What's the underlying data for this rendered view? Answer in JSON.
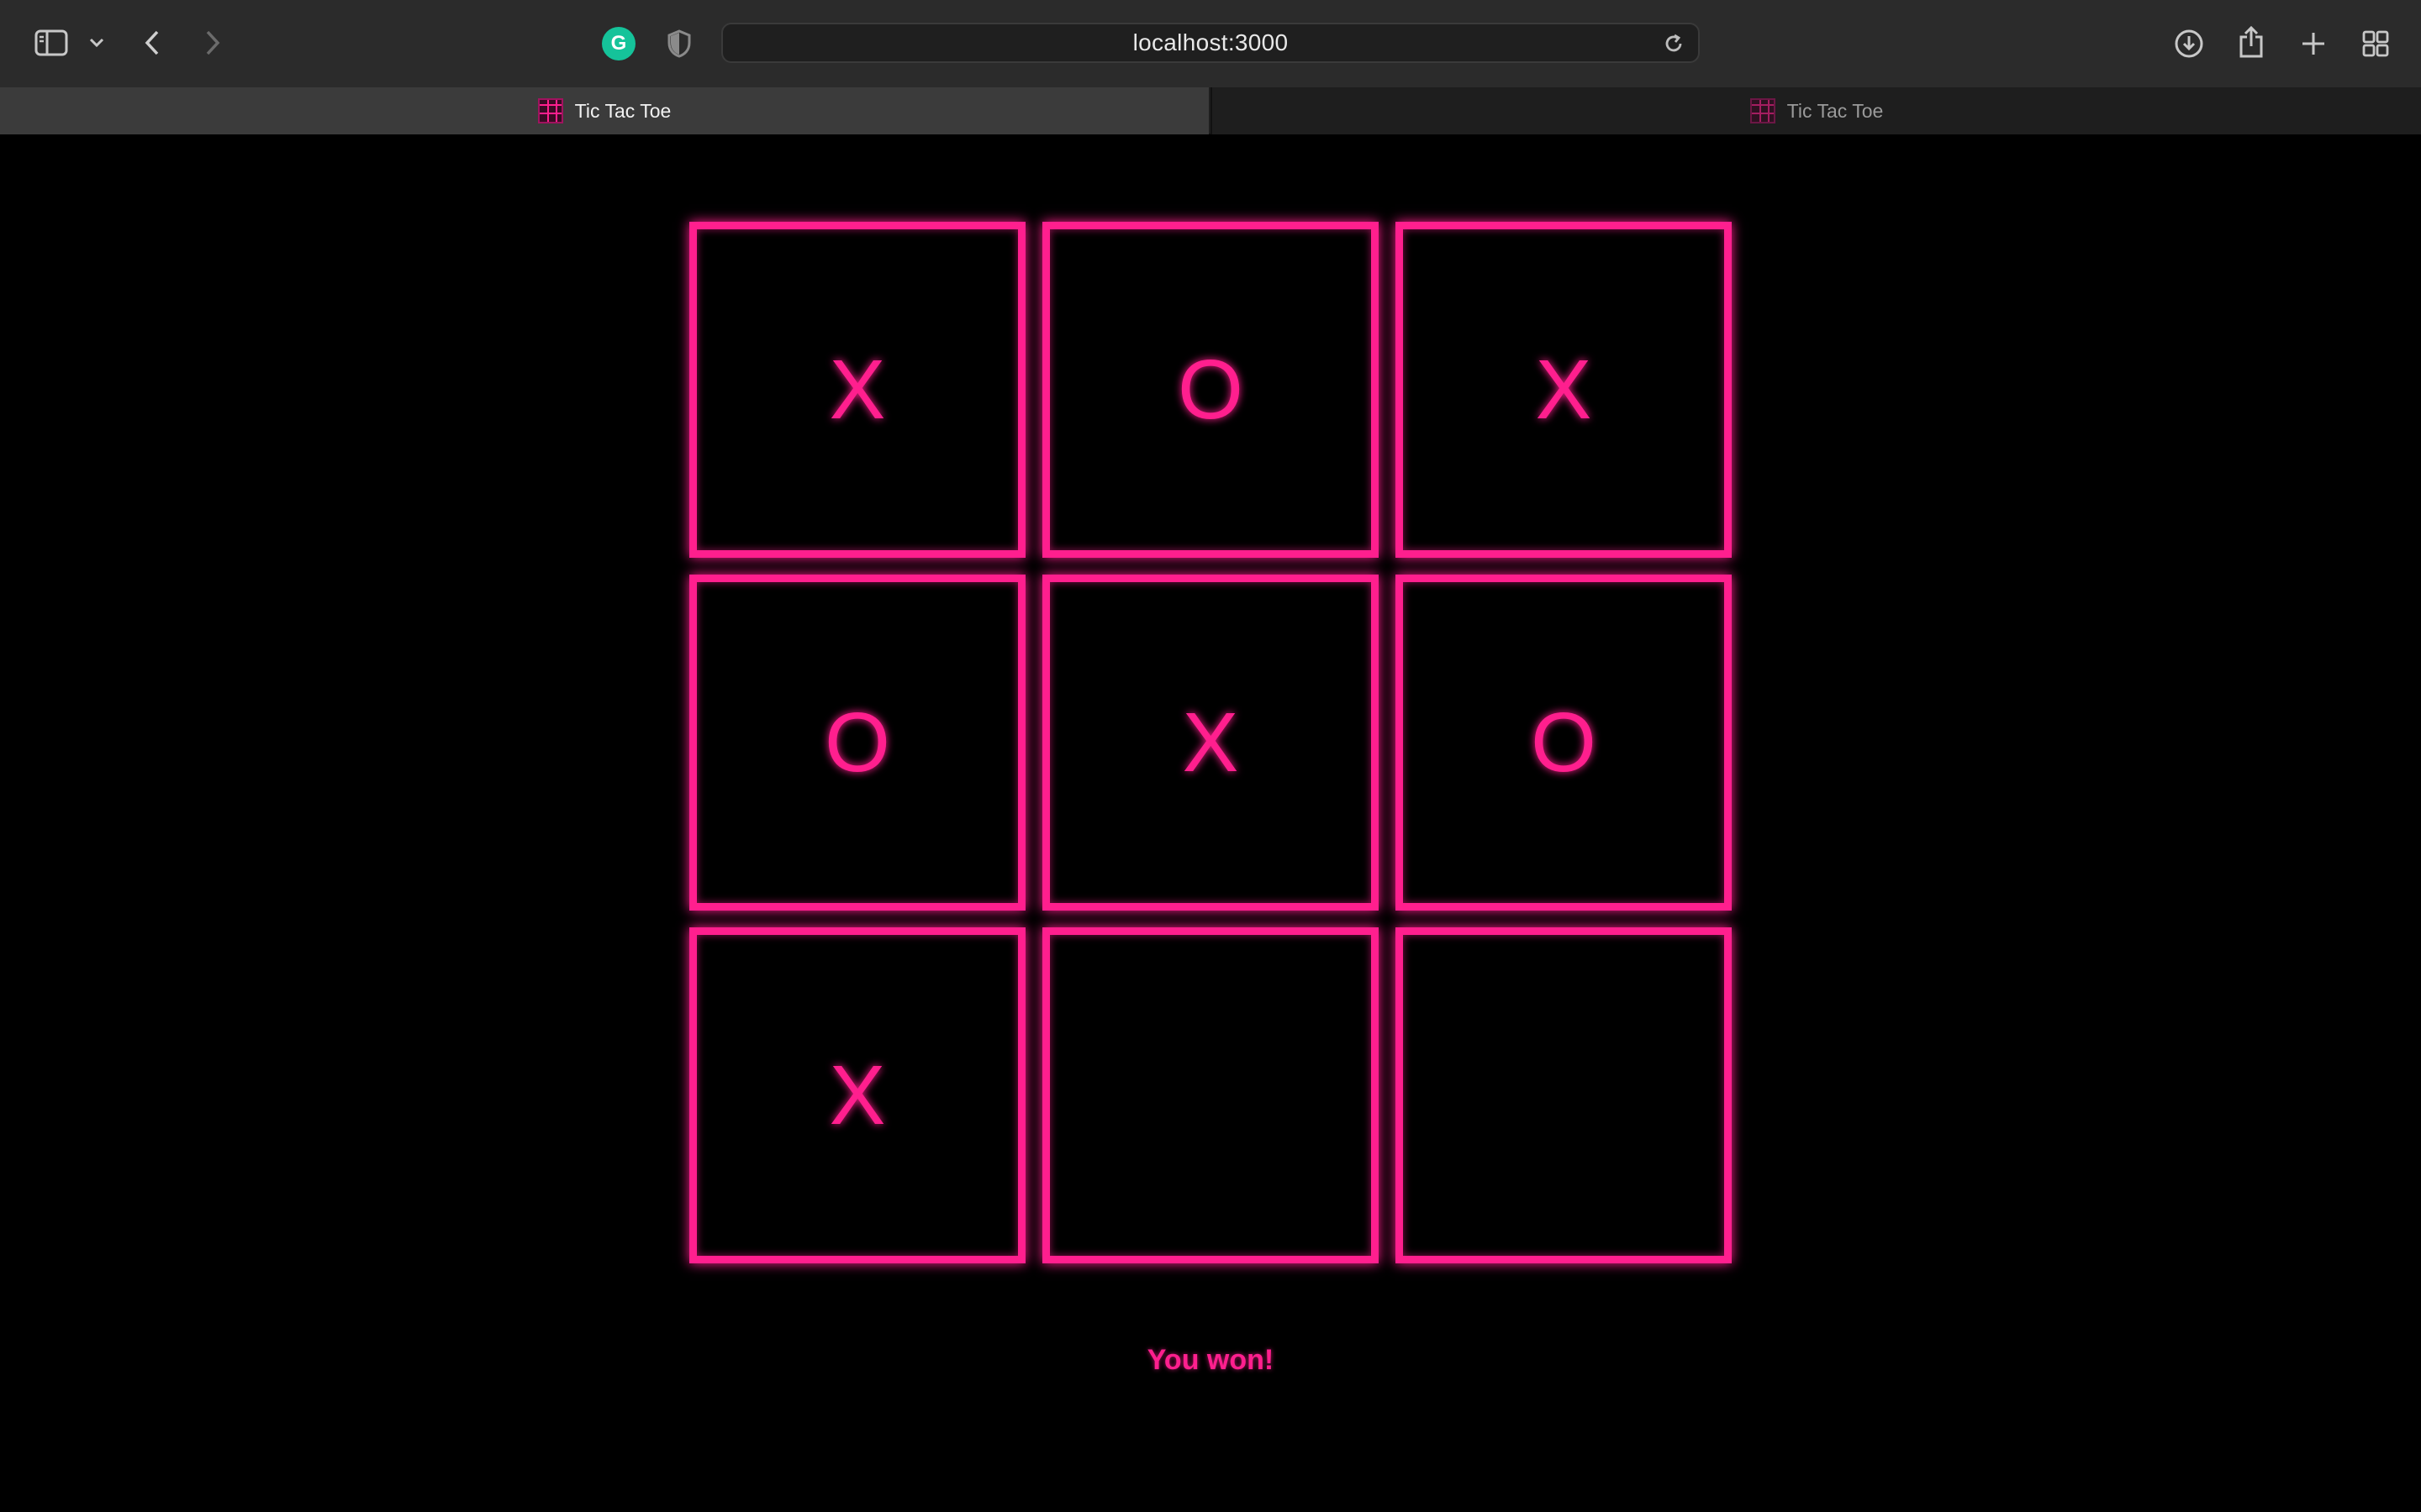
{
  "browser": {
    "url": "localhost:3000",
    "tabs": [
      {
        "title": "Tic Tac Toe",
        "active": true
      },
      {
        "title": "Tic Tac Toe",
        "active": false
      }
    ]
  },
  "game": {
    "cells": [
      "X",
      "O",
      "X",
      "O",
      "X",
      "O",
      "X",
      "",
      ""
    ],
    "status": "You won!"
  },
  "colors": {
    "accent": "#ff1f8e",
    "background": "#000000",
    "toolbar": "#2b2b2b",
    "grammarly": "#15c39a"
  }
}
